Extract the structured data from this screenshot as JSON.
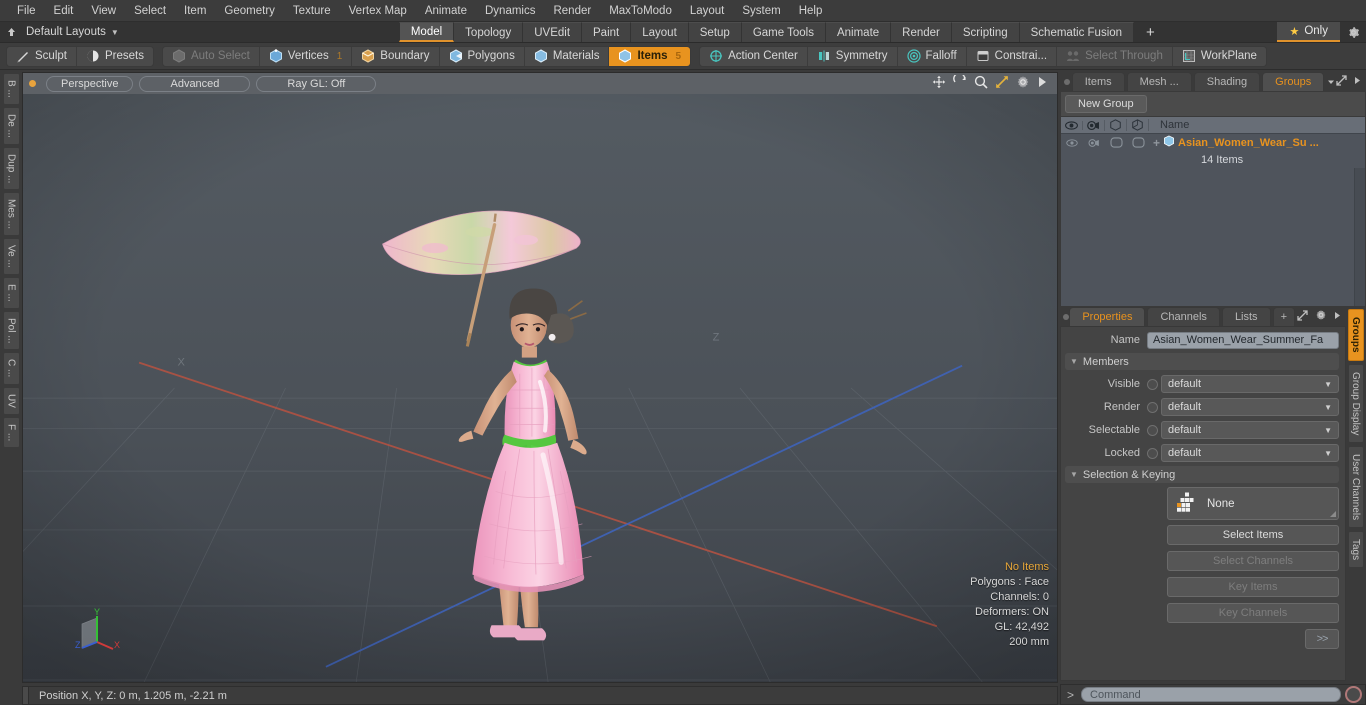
{
  "app": {
    "title": "Modo 3D Modeling Application"
  },
  "menu": {
    "items": [
      "File",
      "Edit",
      "View",
      "Select",
      "Item",
      "Geometry",
      "Texture",
      "Vertex Map",
      "Animate",
      "Dynamics",
      "Render",
      "MaxToModo",
      "Layout",
      "System",
      "Help"
    ]
  },
  "layoutbar": {
    "layout_name": "Default Layouts",
    "caret": "▼",
    "up_icon": "up-arrow-icon",
    "tabs": [
      {
        "label": "Model",
        "active": true
      },
      {
        "label": "Topology",
        "active": false
      },
      {
        "label": "UVEdit",
        "active": false
      },
      {
        "label": "Paint",
        "active": false
      },
      {
        "label": "Layout",
        "active": false
      },
      {
        "label": "Setup",
        "active": false
      },
      {
        "label": "Game Tools",
        "active": false
      },
      {
        "label": "Animate",
        "active": false
      },
      {
        "label": "Render",
        "active": false
      },
      {
        "label": "Scripting",
        "active": false
      },
      {
        "label": "Schematic Fusion",
        "active": false
      }
    ],
    "add_tab": "+",
    "only_label": "Only",
    "only_star": "★",
    "gear": "gear-icon"
  },
  "modebar": {
    "left_group": [
      {
        "label": "Sculpt",
        "icon": "sculpt-icon",
        "state": "normal"
      },
      {
        "label": "Presets",
        "icon": "presets-icon",
        "state": "normal"
      }
    ],
    "select_group": [
      {
        "label": "Auto Select",
        "icon": "cube-grey-icon",
        "state": "dim",
        "count": ""
      },
      {
        "label": "Vertices",
        "icon": "cube-blue-icon",
        "state": "normal",
        "count": "1"
      },
      {
        "label": "Boundary",
        "icon": "cube-edge-icon",
        "state": "normal",
        "count": ""
      },
      {
        "label": "Polygons",
        "icon": "cube-poly-icon",
        "state": "normal",
        "count": ""
      },
      {
        "label": "Materials",
        "icon": "cube-mat-icon",
        "state": "normal",
        "count": ""
      },
      {
        "label": "Items",
        "icon": "cube-items-icon",
        "state": "active",
        "count": "5"
      }
    ],
    "right_group": [
      {
        "label": "Action Center",
        "icon": "action-center-icon",
        "state": "normal"
      },
      {
        "label": "Symmetry",
        "icon": "symmetry-icon",
        "state": "normal"
      },
      {
        "label": "Falloff",
        "icon": "falloff-icon",
        "state": "normal"
      },
      {
        "label": "Constrai...",
        "icon": "constraint-icon",
        "state": "normal"
      },
      {
        "label": "Select Through",
        "icon": "select-through-icon",
        "state": "dim"
      },
      {
        "label": "WorkPlane",
        "icon": "workplane-icon",
        "state": "normal"
      }
    ]
  },
  "left_tabs": [
    "B ...",
    "De ...",
    "Dup ...",
    "Mes ...",
    "Ve ...",
    "E ...",
    "Pol ...",
    "C ...",
    "UV",
    "F ..."
  ],
  "viewport": {
    "header": {
      "dot": "active-dot",
      "view_mode": "Perspective",
      "shading": "Advanced",
      "raygl": "Ray GL: Off",
      "icons": [
        "move-icon",
        "rotate-icon",
        "zoom-icon",
        "fit-icon",
        "settings-icon",
        "play-icon"
      ]
    },
    "axis_labels": {
      "x": "X",
      "z": "Z"
    },
    "gizmo": {
      "x": "X",
      "y": "Y",
      "z": "Z"
    },
    "stats": {
      "items": "No Items",
      "polygons": "Polygons : Face",
      "channels": "Channels: 0",
      "deformers": "Deformers: ON",
      "gl": "GL: 42,492",
      "scale": "200 mm"
    },
    "status_text": "Position X, Y, Z:   0 m, 1.205 m, -2.21 m"
  },
  "right_panel": {
    "top_tabs": [
      {
        "label": "Items",
        "active": false
      },
      {
        "label": "Mesh ...",
        "active": false
      },
      {
        "label": "Shading",
        "active": false
      },
      {
        "label": "Groups",
        "active": true
      }
    ],
    "top_tab_icons": [
      "expand-icon",
      "chevron-right-icon"
    ],
    "new_group_button": "New Group",
    "list_columns": [
      "eye-icon",
      "render-icon",
      "wire-icon",
      "shade-icon",
      "Name"
    ],
    "list_rows": [
      {
        "name": "Asian_Women_Wear_Su ...",
        "sub": "14 Items",
        "icon": "group-icon",
        "expand": "+"
      }
    ]
  },
  "properties": {
    "tabs": [
      {
        "label": "Properties",
        "active": true
      },
      {
        "label": "Channels",
        "active": false
      },
      {
        "label": "Lists",
        "active": false
      },
      {
        "label": "+",
        "active": false
      }
    ],
    "tab_icons": [
      "expand-icon",
      "gear-icon",
      "chevron-right-icon"
    ],
    "name_label": "Name",
    "name_value": "Asian_Women_Wear_Summer_Fa",
    "members_header": "Members",
    "members_rows": [
      {
        "label": "Visible",
        "value": "default"
      },
      {
        "label": "Render",
        "value": "default"
      },
      {
        "label": "Selectable",
        "value": "default"
      },
      {
        "label": "Locked",
        "value": "default"
      }
    ],
    "selection_header": "Selection & Keying",
    "selection_mode": "None",
    "selection_icon": "items-grid-icon",
    "buttons": [
      {
        "label": "Select Items",
        "enabled": true
      },
      {
        "label": "Select Channels",
        "enabled": false
      },
      {
        "label": "Key Items",
        "enabled": false
      },
      {
        "label": "Key Channels",
        "enabled": false
      }
    ],
    "more_button": ">>"
  },
  "right_tabs": [
    {
      "label": "Groups",
      "active": true
    },
    {
      "label": "Group Display",
      "active": false
    },
    {
      "label": "User Channels",
      "active": false
    },
    {
      "label": "Tags",
      "active": false
    }
  ],
  "command_bar": {
    "chevron": ">",
    "placeholder": "Command",
    "record_icon": "record-icon"
  },
  "colors": {
    "accent": "#e8931f",
    "viewport_bg": "#494f55",
    "panel_bg": "#444444",
    "axis_x": "#b04a3a",
    "axis_z": "#3a5fb0",
    "dress_pink": "#f2a8c8",
    "sash_green": "#5ec94a"
  }
}
